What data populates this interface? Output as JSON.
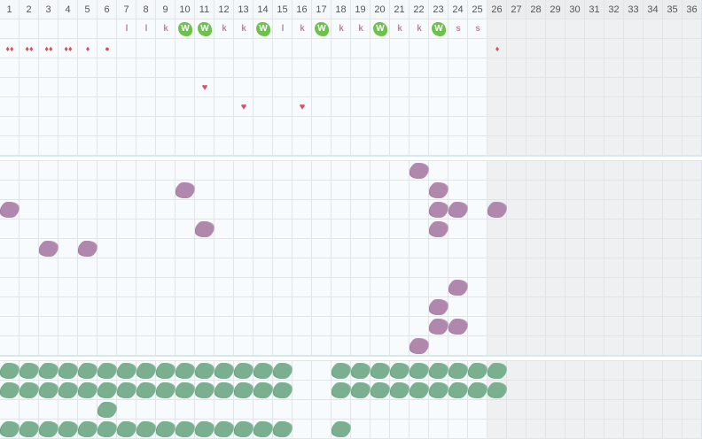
{
  "days": [
    "1",
    "2",
    "3",
    "4",
    "5",
    "6",
    "7",
    "8",
    "9",
    "10",
    "11",
    "12",
    "13",
    "14",
    "15",
    "16",
    "17",
    "18",
    "19",
    "20",
    "21",
    "22",
    "23",
    "24",
    "25",
    "26",
    "27",
    "28",
    "29",
    "30",
    "31",
    "32",
    "33",
    "34",
    "35",
    "36"
  ],
  "today_index": 25,
  "colors": {
    "grid_line": "#d6e8f0",
    "future_bg": "#eef0f1",
    "purple": "#b088ae",
    "green": "#7aaf8f",
    "badge_green": "#6cc24a",
    "letter": "#b5879a",
    "red": "#d4545a"
  },
  "activity_row": [
    {
      "col": 6,
      "type": "letter",
      "text": "l"
    },
    {
      "col": 7,
      "type": "letter",
      "text": "l"
    },
    {
      "col": 8,
      "type": "letter",
      "text": "k"
    },
    {
      "col": 9,
      "type": "badge",
      "text": "W"
    },
    {
      "col": 10,
      "type": "badge",
      "text": "W"
    },
    {
      "col": 11,
      "type": "letter",
      "text": "k"
    },
    {
      "col": 12,
      "type": "letter",
      "text": "k"
    },
    {
      "col": 13,
      "type": "badge",
      "text": "W"
    },
    {
      "col": 14,
      "type": "letter",
      "text": "l"
    },
    {
      "col": 15,
      "type": "letter",
      "text": "k"
    },
    {
      "col": 16,
      "type": "badge",
      "text": "W"
    },
    {
      "col": 17,
      "type": "letter",
      "text": "k"
    },
    {
      "col": 18,
      "type": "letter",
      "text": "k"
    },
    {
      "col": 19,
      "type": "badge",
      "text": "W"
    },
    {
      "col": 20,
      "type": "letter",
      "text": "k"
    },
    {
      "col": 21,
      "type": "letter",
      "text": "k"
    },
    {
      "col": 22,
      "type": "badge",
      "text": "W"
    },
    {
      "col": 23,
      "type": "letter",
      "text": "s"
    },
    {
      "col": 24,
      "type": "letter",
      "text": "s"
    }
  ],
  "symptom_rows": [
    [
      {
        "col": 0,
        "glyph": "♦♦"
      },
      {
        "col": 1,
        "glyph": "♦♦"
      },
      {
        "col": 2,
        "glyph": "♦♦"
      },
      {
        "col": 3,
        "glyph": "♦♦"
      },
      {
        "col": 4,
        "glyph": "♦"
      },
      {
        "col": 5,
        "glyph": "●"
      },
      {
        "col": 25,
        "glyph": "♦"
      }
    ],
    [],
    [
      {
        "col": 10,
        "glyph": "♥"
      }
    ],
    [
      {
        "col": 12,
        "glyph": "♥"
      },
      {
        "col": 15,
        "glyph": "♥"
      }
    ],
    [],
    []
  ],
  "purple_marks": [
    [
      {
        "col": 21
      }
    ],
    [
      {
        "col": 9
      },
      {
        "col": 22
      }
    ],
    [
      {
        "col": 0
      },
      {
        "col": 22
      },
      {
        "col": 23
      },
      {
        "col": 25
      }
    ],
    [
      {
        "col": 10
      },
      {
        "col": 22
      }
    ],
    [
      {
        "col": 2
      },
      {
        "col": 4
      }
    ],
    [],
    [
      {
        "col": 23
      }
    ],
    [
      {
        "col": 22
      }
    ],
    [
      {
        "col": 22
      },
      {
        "col": 23
      }
    ],
    [
      {
        "col": 21
      }
    ]
  ],
  "green_marks": [
    [
      0,
      1,
      2,
      3,
      4,
      5,
      6,
      7,
      8,
      9,
      10,
      11,
      12,
      13,
      14,
      17,
      18,
      19,
      20,
      21,
      22,
      23,
      24,
      25
    ],
    [
      0,
      1,
      2,
      3,
      4,
      5,
      6,
      7,
      8,
      9,
      10,
      11,
      12,
      13,
      14,
      17,
      18,
      19,
      20,
      21,
      22,
      23,
      24,
      25
    ],
    [
      5
    ],
    [
      0,
      1,
      2,
      3,
      4,
      5,
      6,
      7,
      8,
      9,
      10,
      11,
      12,
      13,
      14,
      17
    ]
  ]
}
